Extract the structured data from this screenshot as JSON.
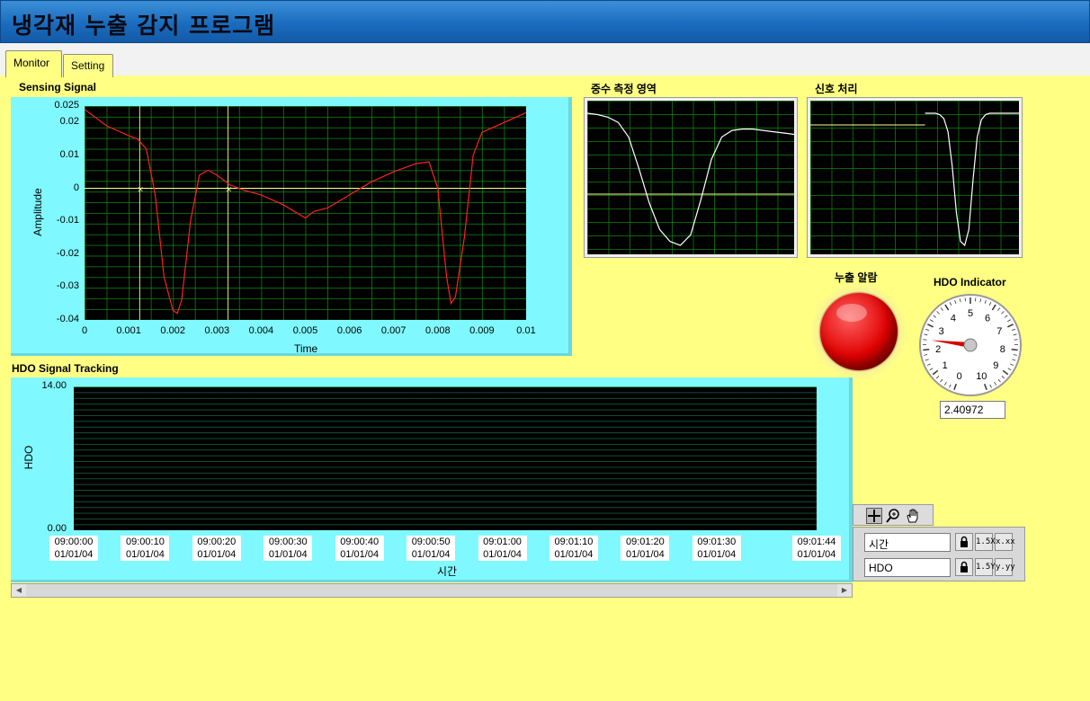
{
  "app": {
    "title": "냉각재 누출 감지 프로그램"
  },
  "tabs": [
    {
      "label": "Monitor"
    },
    {
      "label": "Setting"
    }
  ],
  "sensing": {
    "label": "Sensing Signal",
    "xlabel": "Time",
    "ylabel": "Amplitude",
    "xticks": [
      "0",
      "0.001",
      "0.002",
      "0.003",
      "0.004",
      "0.005",
      "0.006",
      "0.007",
      "0.008",
      "0.009",
      "0.01"
    ],
    "yticks": [
      "0.025",
      "0.02",
      "0.01",
      "0",
      "-0.01",
      "-0.02",
      "-0.03",
      "-0.04"
    ],
    "cursor1": "0.00125",
    "cursor2": "0.00325"
  },
  "mini1": {
    "label": "중수 측정 영역"
  },
  "mini2": {
    "label": "신호 처리"
  },
  "alarm": {
    "label": "누출 알람",
    "color": "#e00000"
  },
  "gauge": {
    "label": "HDO Indicator",
    "ticks": [
      "0",
      "1",
      "2",
      "3",
      "4",
      "5",
      "6",
      "7",
      "8",
      "9",
      "10"
    ],
    "value": 2.40972,
    "display": "2.40972"
  },
  "tracking": {
    "label": "HDO Signal Tracking",
    "ylabel": "HDO",
    "xlabel": "시간",
    "ymax": "14.00",
    "ymin": "0.00",
    "xticks": [
      {
        "time": "09:00:00",
        "date": "01/01/04"
      },
      {
        "time": "09:00:10",
        "date": "01/01/04"
      },
      {
        "time": "09:00:20",
        "date": "01/01/04"
      },
      {
        "time": "09:00:30",
        "date": "01/01/04"
      },
      {
        "time": "09:00:40",
        "date": "01/01/04"
      },
      {
        "time": "09:00:50",
        "date": "01/01/04"
      },
      {
        "time": "09:01:00",
        "date": "01/01/04"
      },
      {
        "time": "09:01:10",
        "date": "01/01/04"
      },
      {
        "time": "09:01:20",
        "date": "01/01/04"
      },
      {
        "time": "09:01:30",
        "date": "01/01/04"
      },
      {
        "time": "09:01:44",
        "date": "01/01/04"
      }
    ]
  },
  "scale_legend": {
    "x_name": "시간",
    "y_name": "HDO",
    "x_format_btn": "1.5X",
    "y_format_btn": "1.5Y",
    "x_precision_btn": "x.xx",
    "y_precision_btn": "y.yy"
  },
  "chart_data": [
    {
      "type": "line",
      "title": "Sensing Signal",
      "xlabel": "Time",
      "ylabel": "Amplitude",
      "xlim": [
        0,
        0.01
      ],
      "ylim": [
        -0.04,
        0.025
      ],
      "grid": true,
      "series": [
        {
          "color": "#ff2020",
          "x": [
            0,
            0.0005,
            0.001,
            0.0012,
            0.0014,
            0.0016,
            0.0018,
            0.002,
            0.0021,
            0.0022,
            0.0024,
            0.0026,
            0.0028,
            0.003,
            0.0033,
            0.0036,
            0.004,
            0.0045,
            0.005,
            0.0052,
            0.0055,
            0.006,
            0.0065,
            0.007,
            0.0075,
            0.0078,
            0.008,
            0.0082,
            0.0083,
            0.0084,
            0.0086,
            0.0088,
            0.009,
            0.0095,
            0.01
          ],
          "y": [
            0.024,
            0.019,
            0.016,
            0.015,
            0.012,
            -0.002,
            -0.027,
            -0.037,
            -0.038,
            -0.034,
            -0.01,
            0.004,
            0.0055,
            0.004,
            0.001,
            -0.0005,
            -0.002,
            -0.005,
            -0.009,
            -0.007,
            -0.006,
            -0.002,
            0.002,
            0.005,
            0.0075,
            0.008,
            0.0,
            -0.027,
            -0.035,
            -0.033,
            -0.015,
            0.01,
            0.017,
            0.02,
            0.023
          ]
        }
      ]
    },
    {
      "type": "line",
      "title": "중수 측정 영역",
      "series": [
        {
          "color": "#ffffff",
          "x": [
            0,
            0.05,
            0.1,
            0.15,
            0.2,
            0.25,
            0.3,
            0.35,
            0.4,
            0.45,
            0.5,
            0.55,
            0.6,
            0.65,
            0.7,
            0.75,
            0.8,
            0.85,
            0.9,
            0.95,
            1.0
          ],
          "y": [
            1.0,
            0.99,
            0.97,
            0.93,
            0.82,
            0.58,
            0.32,
            0.12,
            0.03,
            0.0,
            0.08,
            0.35,
            0.65,
            0.82,
            0.87,
            0.88,
            0.88,
            0.87,
            0.86,
            0.85,
            0.84
          ]
        }
      ]
    },
    {
      "type": "line",
      "title": "신호 처리",
      "series": [
        {
          "color": "#ffffff",
          "x": [
            0.55,
            0.6,
            0.62,
            0.64,
            0.66,
            0.68,
            0.7,
            0.72,
            0.74,
            0.76,
            0.78,
            0.8,
            0.82,
            0.84,
            0.86,
            0.9,
            1.0
          ],
          "y": [
            1.0,
            1.0,
            0.99,
            0.96,
            0.86,
            0.6,
            0.25,
            0.03,
            0.0,
            0.12,
            0.5,
            0.82,
            0.95,
            0.99,
            1.0,
            1.0,
            1.0
          ]
        }
      ]
    },
    {
      "type": "line",
      "title": "HDO Signal Tracking",
      "xlabel": "시간",
      "ylabel": "HDO",
      "ylim": [
        0,
        14
      ],
      "x": [
        "09:00:00",
        "09:00:10",
        "09:00:20",
        "09:00:30",
        "09:00:40",
        "09:00:50",
        "09:01:00",
        "09:01:10",
        "09:01:20",
        "09:01:30",
        "09:01:44"
      ],
      "series": []
    }
  ]
}
